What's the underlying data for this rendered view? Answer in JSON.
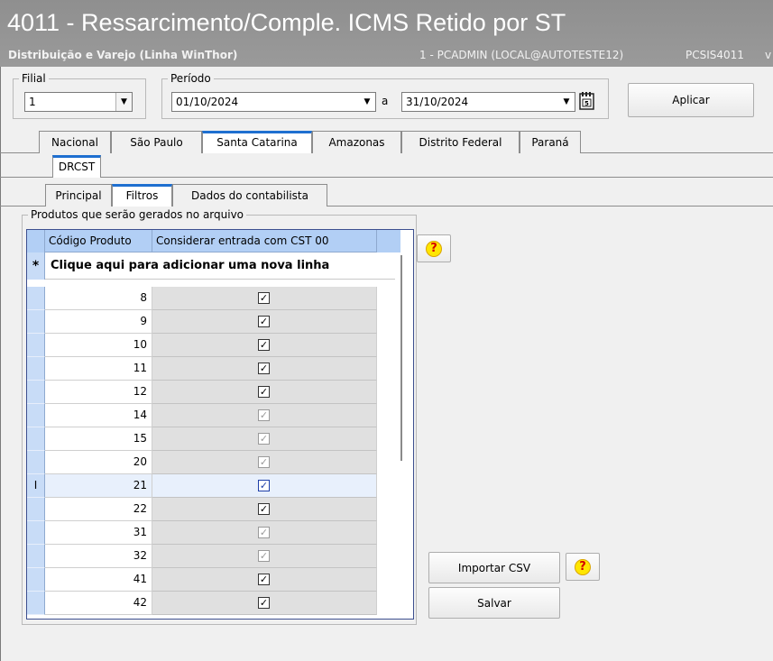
{
  "window": {
    "title": "4011 - Ressarcimento/Comple. ICMS Retido por ST",
    "subtitle": "Distribuição e Varejo (Linha WinThor)",
    "user_info": "1 - PCADMIN (LOCAL@AUTOTESTE12)",
    "program": "PCSIS4011",
    "extra": "v"
  },
  "filial": {
    "label": "Filial",
    "value": "1"
  },
  "periodo": {
    "label": "Período",
    "start": "01/10/2024",
    "separator": "a",
    "end": "31/10/2024"
  },
  "buttons": {
    "apply": "Aplicar",
    "import_csv": "Importar CSV",
    "save": "Salvar",
    "help": "?"
  },
  "state_tabs": [
    {
      "label": "Nacional",
      "active": false
    },
    {
      "label": "São Paulo",
      "active": false
    },
    {
      "label": "Santa Catarina",
      "active": true
    },
    {
      "label": "Amazonas",
      "active": false
    },
    {
      "label": "Distrito Federal",
      "active": false
    },
    {
      "label": "Paraná",
      "active": false
    }
  ],
  "sub_tabs": [
    {
      "label": "DRCST",
      "active": true
    }
  ],
  "section_tabs": [
    {
      "label": "Principal",
      "active": false
    },
    {
      "label": "Filtros",
      "active": true
    },
    {
      "label": "Dados do contabilista",
      "active": false
    }
  ],
  "products_group": {
    "label": "Produtos que serão gerados no arquivo",
    "columns": [
      "Código Produto",
      "Considerar entrada com CST 00"
    ],
    "new_row_marker": "*",
    "new_row_text": "Clique aqui para adicionar uma nova linha",
    "rows": [
      {
        "code": "8",
        "checked": true,
        "style": "normal"
      },
      {
        "code": "9",
        "checked": true,
        "style": "normal"
      },
      {
        "code": "10",
        "checked": true,
        "style": "normal"
      },
      {
        "code": "11",
        "checked": true,
        "style": "normal"
      },
      {
        "code": "12",
        "checked": true,
        "style": "normal"
      },
      {
        "code": "14",
        "checked": true,
        "style": "dim"
      },
      {
        "code": "15",
        "checked": true,
        "style": "dim"
      },
      {
        "code": "20",
        "checked": true,
        "style": "dim"
      },
      {
        "code": "21",
        "checked": true,
        "style": "blue",
        "selected": true,
        "marker": "I"
      },
      {
        "code": "22",
        "checked": true,
        "style": "normal"
      },
      {
        "code": "31",
        "checked": true,
        "style": "dim"
      },
      {
        "code": "32",
        "checked": true,
        "style": "dim"
      },
      {
        "code": "41",
        "checked": true,
        "style": "normal"
      },
      {
        "code": "42",
        "checked": true,
        "style": "normal"
      }
    ]
  },
  "colors": {
    "tab_accent": "#1e6fd0",
    "grid_header": "#b2cff5",
    "title_bar": "#939393"
  }
}
